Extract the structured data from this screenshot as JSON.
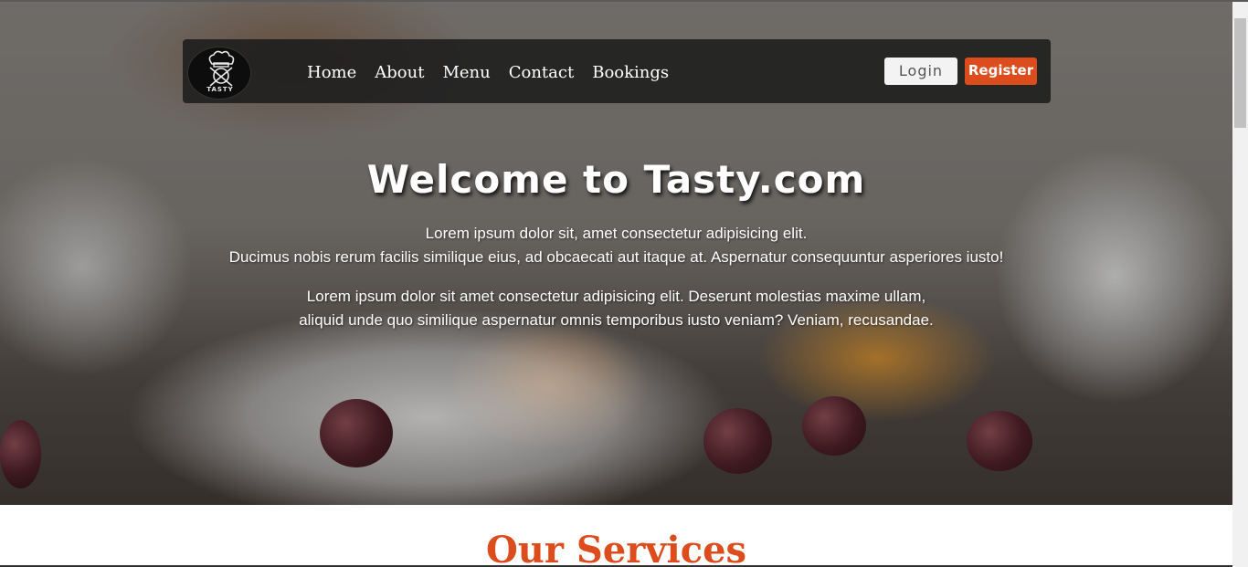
{
  "brand": {
    "logo_text": "TASTY"
  },
  "nav": {
    "links": [
      "Home",
      "About",
      "Menu",
      "Contact",
      "Bookings"
    ],
    "login_label": "Login",
    "register_label": "Register"
  },
  "hero": {
    "title": "Welcome to Tasty.com",
    "paragraph1_line1": "Lorem ipsum dolor sit, amet consectetur adipisicing elit.",
    "paragraph1_line2": "Ducimus nobis rerum facilis similique eius, ad obcaecati aut itaque at. Aspernatur consequuntur asperiores iusto!",
    "paragraph2_line1": "Lorem ipsum dolor sit amet consectetur adipisicing elit. Deserunt molestias maxime ullam,",
    "paragraph2_line2": "aliquid unde quo similique aspernatur omnis temporibus iusto veniam? Veniam, recusandae."
  },
  "services": {
    "title": "Our Services"
  },
  "colors": {
    "accent": "#dc4c1d",
    "navbar_bg": "#1c1c1c",
    "login_bg": "#f3f3f3"
  },
  "icons": {
    "logo": "chef-hat-icon"
  }
}
